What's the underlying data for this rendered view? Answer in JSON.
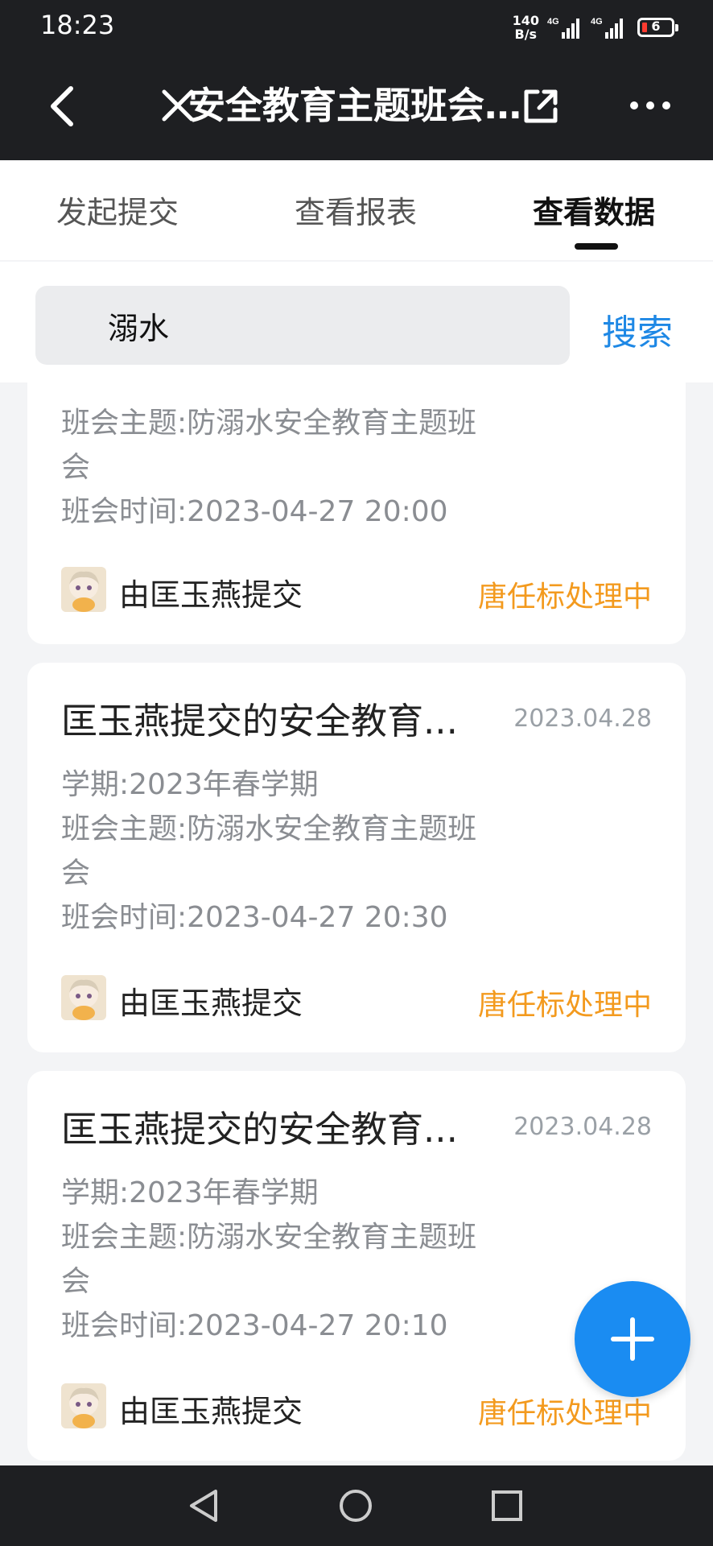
{
  "status_bar": {
    "time": "18:23",
    "net_speed_value": "140",
    "net_speed_unit": "B/s",
    "signal_label": "4G",
    "battery_level": "6"
  },
  "header": {
    "title": "安全教育主题班会...",
    "icons": [
      "back-icon",
      "close-icon",
      "share-icon",
      "more-icon"
    ]
  },
  "tabs": [
    {
      "label": "发起提交"
    },
    {
      "label": "查看报表"
    },
    {
      "label": "查看数据"
    }
  ],
  "active_tab": "查看数据",
  "search": {
    "value": "溺水",
    "button_label": "搜索"
  },
  "cards": [
    {
      "title": "",
      "date": "",
      "semester": "",
      "topic_line1": "班会主题:防溺水安全教育主题班",
      "topic_line2": "会",
      "time": "班会时间:2023-04-27 20:00",
      "submitter": "由匡玉燕提交",
      "status": "唐任标处理中"
    },
    {
      "title": "匡玉燕提交的安全教育...",
      "date": "2023.04.28",
      "semester": "学期:2023年春学期",
      "topic_line1": "班会主题:防溺水安全教育主题班",
      "topic_line2": "会",
      "time": "班会时间:2023-04-27 20:30",
      "submitter": "由匡玉燕提交",
      "status": "唐任标处理中"
    },
    {
      "title": "匡玉燕提交的安全教育...",
      "date": "2023.04.28",
      "semester": "学期:2023年春学期",
      "topic_line1": "班会主题:防溺水安全教育主题班",
      "topic_line2": "会",
      "time": "班会时间:2023-04-27 20:10",
      "submitter": "由匡玉燕提交",
      "status": "唐任标处理中"
    }
  ],
  "colors": {
    "accent_blue": "#1e88e5",
    "status_orange": "#f39a1e",
    "dark_bar": "#1e1f22",
    "fab_blue": "#1a8cf2"
  }
}
